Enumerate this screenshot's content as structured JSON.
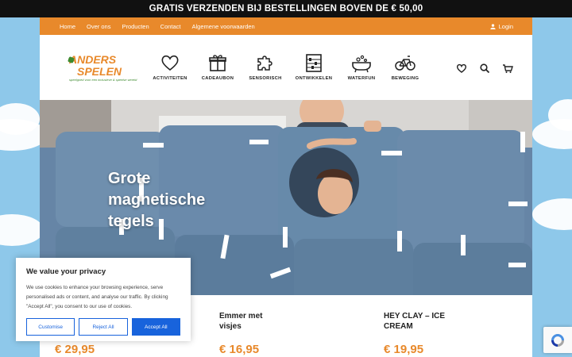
{
  "announcement": "GRATIS VERZENDEN BIJ BESTELLINGEN BOVEN DE € 50,00",
  "nav": {
    "items": [
      "Home",
      "Over ons",
      "Producten",
      "Contact",
      "Algemene voorwaarden"
    ],
    "login": "Login"
  },
  "logo": {
    "line1": "ANDERS",
    "line2": "SPELEN",
    "tagline": "speelgoed voor een inclusieve & speelse wereld"
  },
  "categories": [
    {
      "label": "ACTIVITEITEN",
      "icon": "heart-icon"
    },
    {
      "label": "CADEAUBON",
      "icon": "gift-icon"
    },
    {
      "label": "SENSORISCH",
      "icon": "puzzle-icon"
    },
    {
      "label": "ONTWIKKELEN",
      "icon": "abacus-icon"
    },
    {
      "label": "WATERFUN",
      "icon": "bathtub-icon"
    },
    {
      "label": "BEWEGING",
      "icon": "bicycle-icon"
    }
  ],
  "header_icons": [
    "wishlist-heart-icon",
    "search-icon",
    "cart-icon"
  ],
  "hero": {
    "line1": "Grote",
    "line2": "magnetische",
    "line3": "tegels"
  },
  "products": [
    {
      "name": "",
      "price": "€ 29,95"
    },
    {
      "name": "Emmer met visjes",
      "price": "€ 16,95"
    },
    {
      "name": "HEY CLAY – ICE CREAM",
      "price": "€ 19,95"
    }
  ],
  "cookie": {
    "title": "We value your privacy",
    "text": "We use cookies to enhance your browsing experience, serve personalised ads or content, and analyse our traffic. By clicking \"Accept All\", you consent to our use of cookies.",
    "customise": "Customise",
    "reject": "Reject All",
    "accept": "Accept All"
  },
  "colors": {
    "accent": "#e8892b",
    "brand_green": "#3d8a2f",
    "button_blue": "#1863dc",
    "sky": "#8ec8ea"
  }
}
